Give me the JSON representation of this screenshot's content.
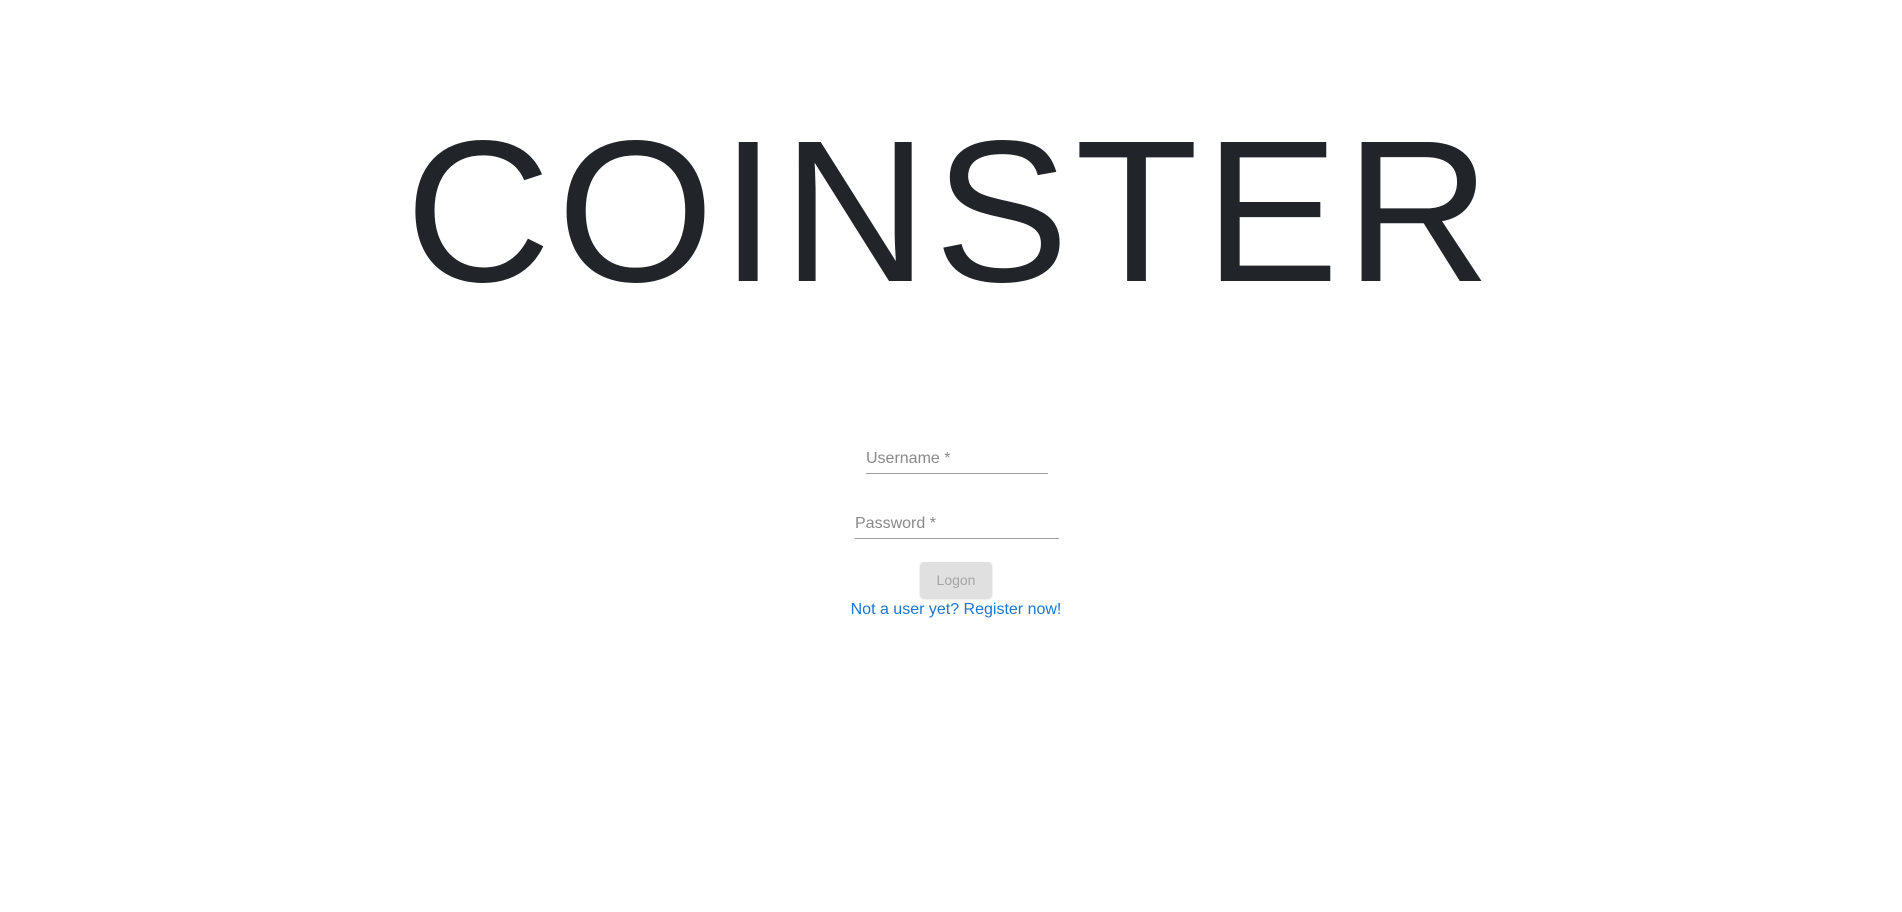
{
  "app": {
    "title": "COINSTER"
  },
  "login_form": {
    "username": {
      "value": "",
      "placeholder": "Username *"
    },
    "password": {
      "value": "",
      "placeholder": "Password *"
    },
    "logon_label": "Logon",
    "logon_disabled": true,
    "register_link_text": "Not a user yet? Register now!"
  },
  "colors": {
    "title": "#212529",
    "link": "#1976d2",
    "button_disabled_bg": "#e0e0e0",
    "button_disabled_text": "#a6a6a6",
    "placeholder": "#8a8a8a",
    "underline": "#9e9e9e"
  }
}
